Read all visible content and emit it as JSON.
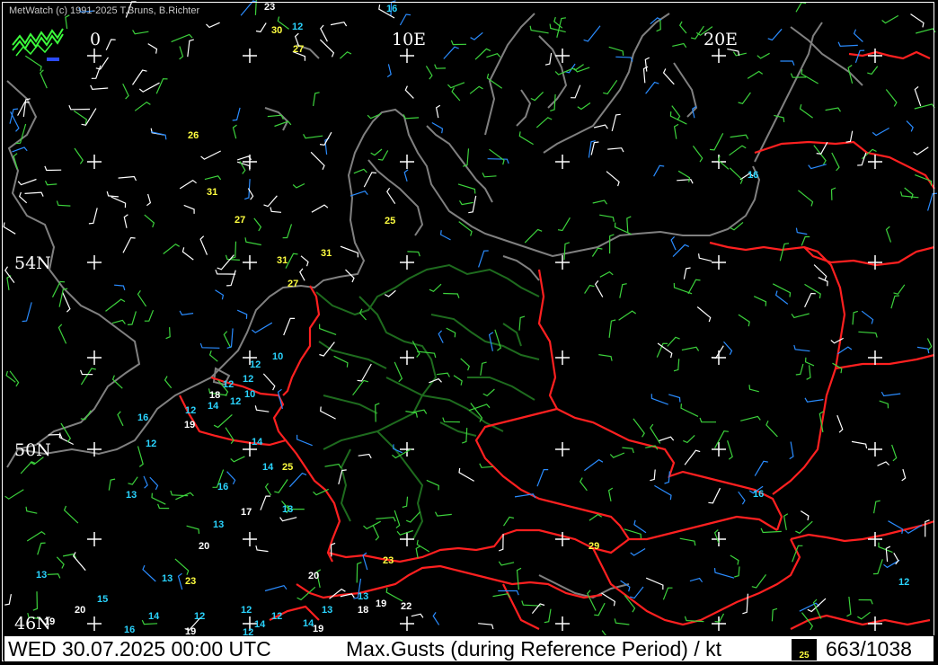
{
  "header": {
    "credit": "MetWatch  (c) 1991-2025 T.Bruns, B.Richter"
  },
  "axis_labels": {
    "lon_0": "0",
    "lon_10e": "10E",
    "lon_20e": "20E",
    "lat_54n": "54N",
    "lat_50n": "50N",
    "lat_46n": "46N"
  },
  "status_bar": {
    "datetime": "WED 30.07.2025 00:00 UTC",
    "parameter": "Max.Gusts (during Reference Period) / kt",
    "reference_value": "25",
    "frame_counter": "663/1038"
  },
  "colors": {
    "background": "#000000",
    "coastline": "#808080",
    "country_border": "#ff2020",
    "state_border": "#1e6b1e",
    "gust_low": "#2ad4ff",
    "gust_mid": "#ffffff",
    "gust_high": "#ffff40"
  },
  "gust_labels": [
    {
      "text": "23",
      "color": "white"
    },
    {
      "text": "16",
      "color": "cyan"
    },
    {
      "text": "30",
      "color": "yellow"
    },
    {
      "text": "12",
      "color": "cyan"
    },
    {
      "text": "27",
      "color": "yellow"
    },
    {
      "text": "26",
      "color": "yellow"
    },
    {
      "text": "31",
      "color": "yellow"
    },
    {
      "text": "27",
      "color": "yellow"
    },
    {
      "text": "25",
      "color": "yellow"
    },
    {
      "text": "16",
      "color": "cyan"
    },
    {
      "text": "31",
      "color": "yellow"
    },
    {
      "text": "31",
      "color": "yellow"
    },
    {
      "text": "27",
      "color": "yellow"
    },
    {
      "text": "10",
      "color": "cyan"
    },
    {
      "text": "12",
      "color": "cyan"
    },
    {
      "text": "12",
      "color": "cyan"
    },
    {
      "text": "12",
      "color": "cyan"
    },
    {
      "text": "18",
      "color": "white"
    },
    {
      "text": "10",
      "color": "cyan"
    },
    {
      "text": "12",
      "color": "cyan"
    },
    {
      "text": "14",
      "color": "cyan"
    },
    {
      "text": "12",
      "color": "cyan"
    },
    {
      "text": "16",
      "color": "cyan"
    },
    {
      "text": "19",
      "color": "white"
    },
    {
      "text": "12",
      "color": "cyan"
    },
    {
      "text": "14",
      "color": "cyan"
    },
    {
      "text": "14",
      "color": "cyan"
    },
    {
      "text": "25",
      "color": "yellow"
    },
    {
      "text": "13",
      "color": "cyan"
    },
    {
      "text": "16",
      "color": "cyan"
    },
    {
      "text": "13",
      "color": "cyan"
    },
    {
      "text": "17",
      "color": "white"
    },
    {
      "text": "13",
      "color": "cyan"
    },
    {
      "text": "13",
      "color": "cyan"
    },
    {
      "text": "20",
      "color": "white"
    },
    {
      "text": "16",
      "color": "cyan"
    },
    {
      "text": "29",
      "color": "yellow"
    },
    {
      "text": "13",
      "color": "cyan"
    },
    {
      "text": "12",
      "color": "cyan"
    },
    {
      "text": "23",
      "color": "yellow"
    },
    {
      "text": "20",
      "color": "white"
    },
    {
      "text": "23",
      "color": "yellow"
    },
    {
      "text": "15",
      "color": "cyan"
    },
    {
      "text": "20",
      "color": "white"
    },
    {
      "text": "13",
      "color": "cyan"
    },
    {
      "text": "19",
      "color": "white"
    },
    {
      "text": "22",
      "color": "white"
    },
    {
      "text": "18",
      "color": "white"
    },
    {
      "text": "13",
      "color": "cyan"
    },
    {
      "text": "14",
      "color": "cyan"
    },
    {
      "text": "12",
      "color": "cyan"
    },
    {
      "text": "19",
      "color": "white"
    },
    {
      "text": "16",
      "color": "cyan"
    },
    {
      "text": "14",
      "color": "cyan"
    },
    {
      "text": "12",
      "color": "cyan"
    },
    {
      "text": "12",
      "color": "cyan"
    },
    {
      "text": "14",
      "color": "cyan"
    },
    {
      "text": "19",
      "color": "white"
    },
    {
      "text": "19",
      "color": "white"
    },
    {
      "text": "12",
      "color": "cyan"
    }
  ]
}
